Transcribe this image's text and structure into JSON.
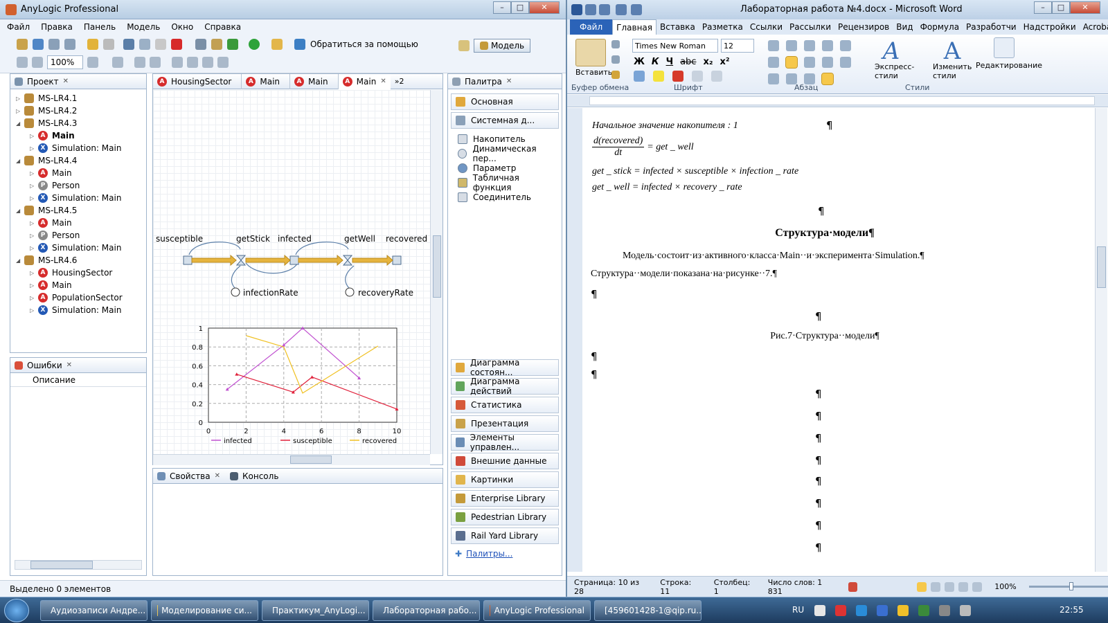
{
  "anylogic": {
    "title": "AnyLogic Professional",
    "menu": [
      "Файл",
      "Правка",
      "Панель",
      "Модель",
      "Окно",
      "Справка"
    ],
    "zoom": "100%",
    "help_label": "Обратиться за помощью",
    "model_button": "Модель",
    "project_tab": "Проект",
    "tree": [
      {
        "label": "MS-LR4.1",
        "level": 0,
        "kind": "m",
        "exp": "▷"
      },
      {
        "label": "MS-LR4.2",
        "level": 0,
        "kind": "m",
        "exp": "▷"
      },
      {
        "label": "MS-LR4.3",
        "level": 0,
        "kind": "m",
        "exp": "◢"
      },
      {
        "label": "Main",
        "level": 1,
        "kind": "a",
        "exp": "▷",
        "bold": true
      },
      {
        "label": "Simulation: Main",
        "level": 1,
        "kind": "s",
        "exp": "▷"
      },
      {
        "label": "MS-LR4.4",
        "level": 0,
        "kind": "m",
        "exp": "◢"
      },
      {
        "label": "Main",
        "level": 1,
        "kind": "a",
        "exp": "▷"
      },
      {
        "label": "Person",
        "level": 1,
        "kind": "p",
        "exp": "▷"
      },
      {
        "label": "Simulation: Main",
        "level": 1,
        "kind": "s",
        "exp": "▷"
      },
      {
        "label": "MS-LR4.5",
        "level": 0,
        "kind": "m",
        "exp": "◢"
      },
      {
        "label": "Main",
        "level": 1,
        "kind": "a",
        "exp": "▷"
      },
      {
        "label": "Person",
        "level": 1,
        "kind": "p",
        "exp": "▷"
      },
      {
        "label": "Simulation: Main",
        "level": 1,
        "kind": "s",
        "exp": "▷"
      },
      {
        "label": "MS-LR4.6",
        "level": 0,
        "kind": "m",
        "exp": "◢"
      },
      {
        "label": "HousingSector",
        "level": 1,
        "kind": "a",
        "exp": "▷"
      },
      {
        "label": "Main",
        "level": 1,
        "kind": "a",
        "exp": "▷"
      },
      {
        "label": "PopulationSector",
        "level": 1,
        "kind": "a",
        "exp": "▷"
      },
      {
        "label": "Simulation: Main",
        "level": 1,
        "kind": "s",
        "exp": "▷"
      }
    ],
    "errors_tab": "Ошибки",
    "errors_col": "Описание",
    "editor_tabs": [
      "HousingSector",
      "Main",
      "Main",
      "Main"
    ],
    "editor_more": "»2",
    "diagram": {
      "susceptible": "susceptible",
      "getStick": "getStick",
      "infected": "infected",
      "getWell": "getWell",
      "recovered": "recovered",
      "infectionRate": "infectionRate",
      "recoveryRate": "recoveryRate"
    },
    "palette_tab": "Палитра",
    "palette_top": [
      "Основная",
      "Системная д..."
    ],
    "palette_items": [
      "Накопитель",
      "Динамическая пер...",
      "Параметр",
      "Табличная функция",
      "Соединитель"
    ],
    "palette_bottom": [
      "Диаграмма состоян...",
      "Диаграмма действий",
      "Статистика",
      "Презентация",
      "Элементы управлен...",
      "Внешние данные",
      "Картинки",
      "Enterprise Library",
      "Pedestrian Library",
      "Rail Yard Library"
    ],
    "palette_link": "Палитры...",
    "props_tab": "Свойства",
    "console_tab": "Консоль",
    "status": "Выделено 0 элементов"
  },
  "chart_data": {
    "type": "line",
    "xlim": [
      0,
      10
    ],
    "ylim": [
      0,
      1
    ],
    "xticks": [
      "0",
      "2",
      "4",
      "6",
      "8",
      "10"
    ],
    "yticks": [
      "0",
      "0.2",
      "0.4",
      "0.6",
      "0.8",
      "1"
    ],
    "legend_position": "bottom",
    "series": [
      {
        "name": "infected",
        "color": "#c050d0",
        "x": [
          1,
          4,
          5,
          8
        ],
        "y": [
          0.35,
          0.82,
          1.0,
          0.47
        ]
      },
      {
        "name": "susceptible",
        "color": "#e0203a",
        "x": [
          1.5,
          4.5,
          5.5,
          10
        ],
        "y": [
          0.51,
          0.32,
          0.48,
          0.14
        ]
      },
      {
        "name": "recovered",
        "color": "#f0c020",
        "x": [
          2,
          4,
          5,
          9
        ],
        "y": [
          0.92,
          0.8,
          0.31,
          0.81
        ]
      }
    ]
  },
  "word": {
    "title": "Лабораторная работа №4.docx - Microsoft Word",
    "tabs": [
      "Файл",
      "Главная",
      "Вставка",
      "Разметка стр",
      "Ссылки",
      "Рассылки",
      "Рецензиров",
      "Вид",
      "Формула",
      "Разработчи",
      "Надстройки",
      "Acrobat"
    ],
    "paste": "Вставить",
    "font": "Times New Roman",
    "size": "12",
    "styles1": "Экспресс-стили",
    "styles2": "Изменить стили",
    "editing": "Редактирование",
    "groups": [
      "Буфер обмена",
      "Шрифт",
      "Абзац",
      "Стили"
    ],
    "eq_initial": "Начальное значение накопителя : 1",
    "eq_d_num": "d(recovered)",
    "eq_d_den": "dt",
    "eq_d_rhs": "= get _ well",
    "eq_stick": "get _ stick = infected × susceptible × infection _ rate",
    "eq_well": "get _ well = infected × recovery _ rate",
    "heading": "Структура·модели",
    "para1": "Модель·состоит·из·активного·класса·Main··и·эксперимента·Simulation.",
    "para2": "Структура··модели·показана·на·рисунке··7.",
    "caption": "Рис.7·Структура··модели",
    "pilcrow": "¶",
    "status": [
      "Страница: 10 из 28",
      "Строка: 11",
      "Столбец: 1",
      "Число слов: 1 831"
    ],
    "zoom": "100%"
  },
  "taskbar": {
    "items": [
      "Аудиозаписи Андре...",
      "Моделирование си...",
      "Практикум_AnyLogi...",
      "Лабораторная рабо...",
      "AnyLogic Professional",
      "[459601428-1@qip.ru..."
    ],
    "lang": "RU",
    "time": "22:55"
  }
}
